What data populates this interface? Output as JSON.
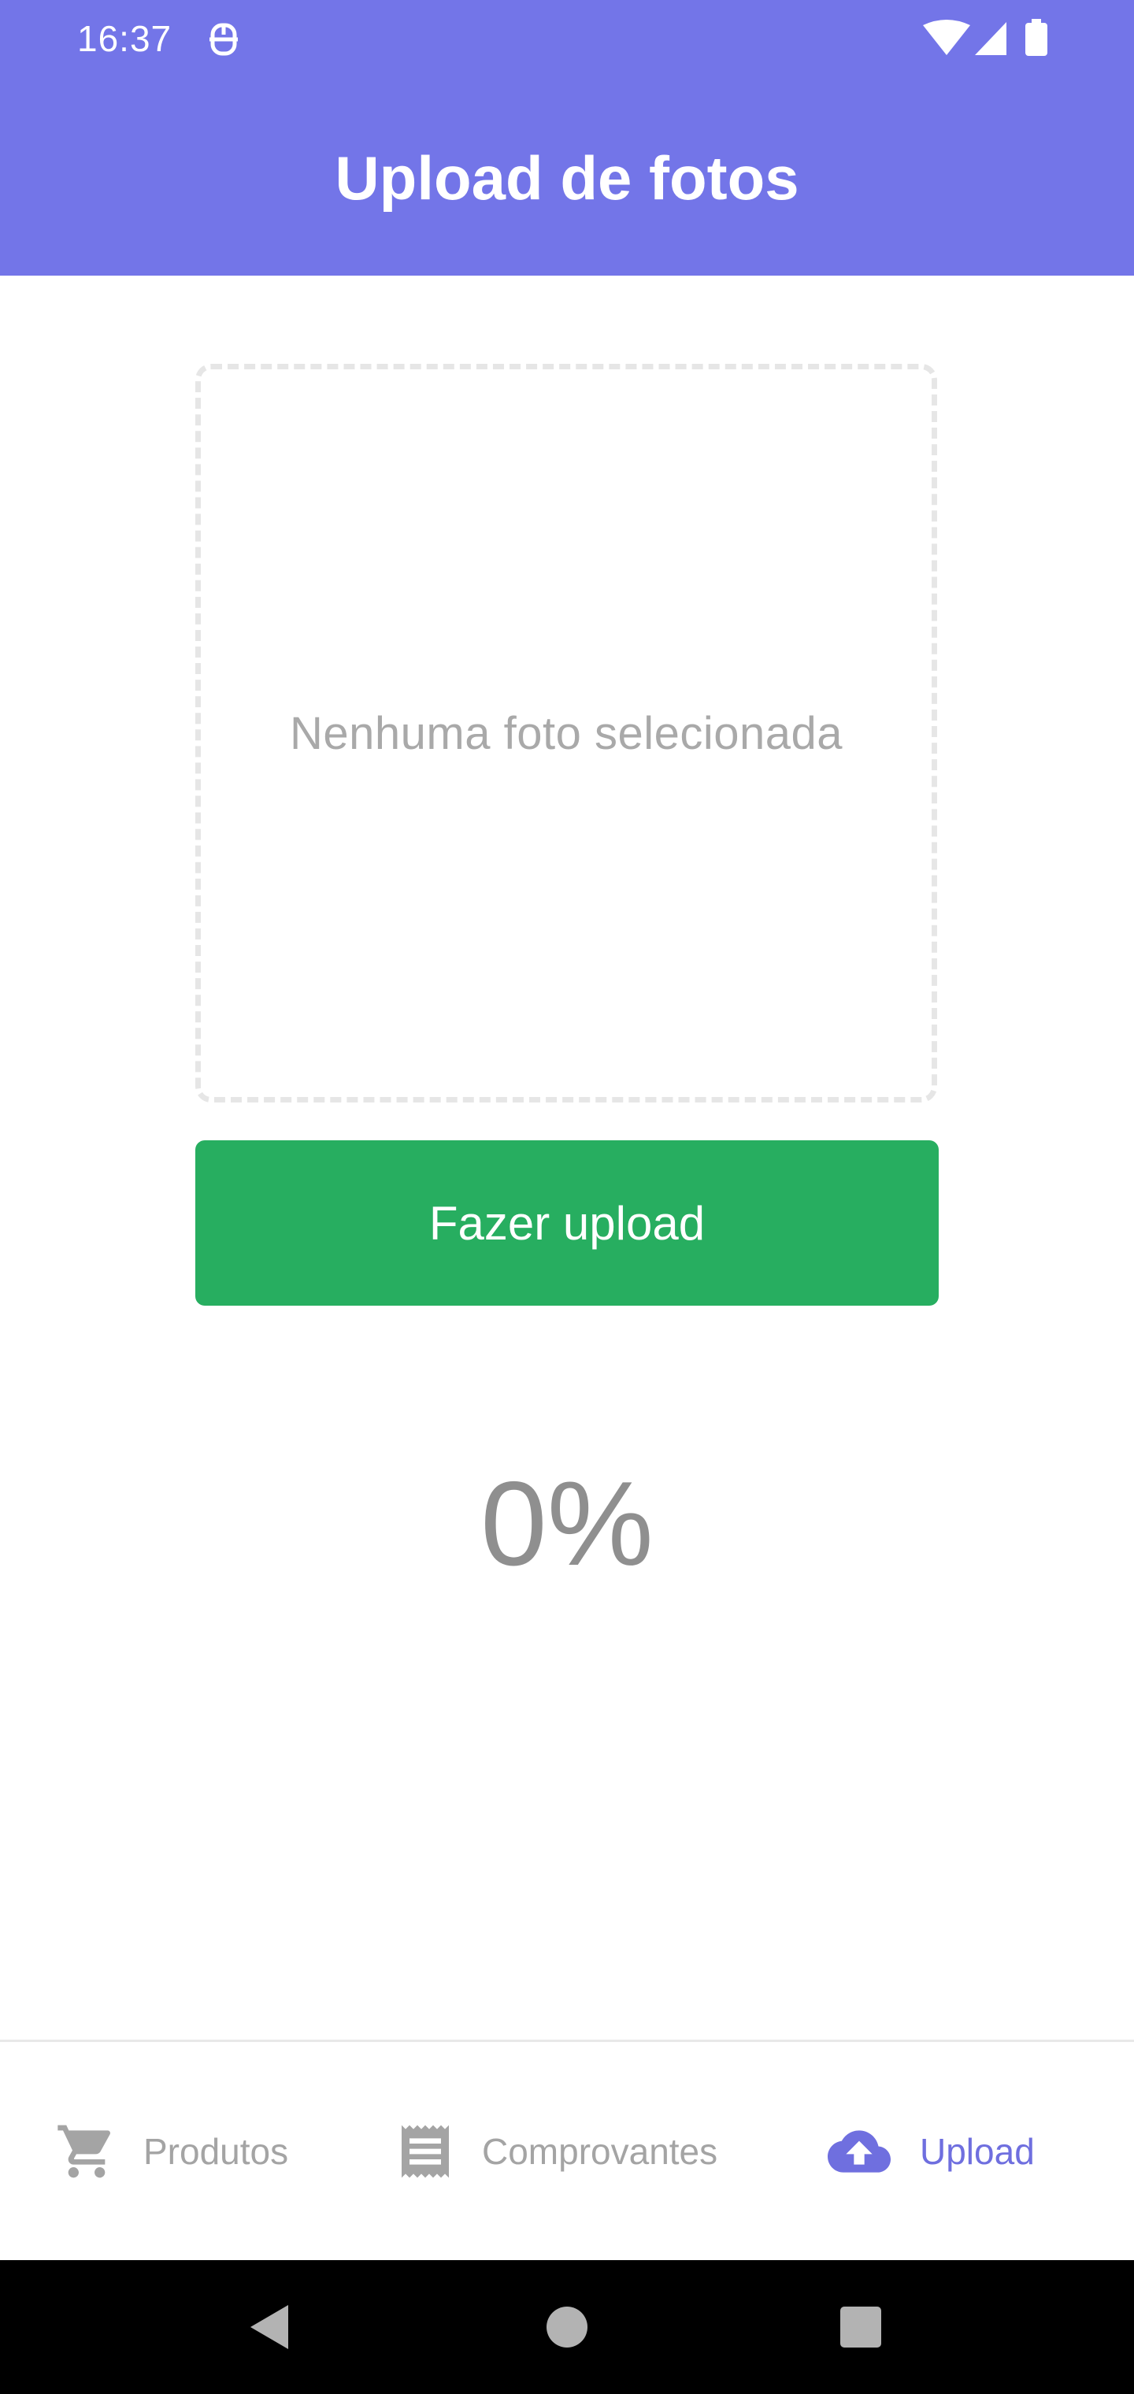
{
  "status_bar": {
    "time": "16:37",
    "notification_icon": "keyboard-accessory-icon",
    "wifi_icon": "wifi-icon",
    "signal_icon": "cell-signal-icon",
    "battery_icon": "battery-icon"
  },
  "header": {
    "title": "Upload de fotos",
    "background_color": "#7375E8"
  },
  "photo_picker": {
    "empty_text": "Nenhuma foto selecionada"
  },
  "upload_button": {
    "label": "Fazer upload",
    "color": "#27AE60"
  },
  "progress": {
    "text": "0%",
    "value": 0
  },
  "tab_bar": {
    "active_color": "#6F6FDF",
    "inactive_color": "#A4A4A4",
    "items": [
      {
        "label": "Produtos",
        "icon": "shopping-cart-icon",
        "active": false
      },
      {
        "label": "Comprovantes",
        "icon": "receipt-icon",
        "active": false
      },
      {
        "label": "Upload",
        "icon": "cloud-upload-icon",
        "active": true
      }
    ]
  },
  "system_nav": {
    "back_icon": "back-triangle-icon",
    "home_icon": "home-circle-icon",
    "recent_icon": "recent-apps-square-icon"
  }
}
